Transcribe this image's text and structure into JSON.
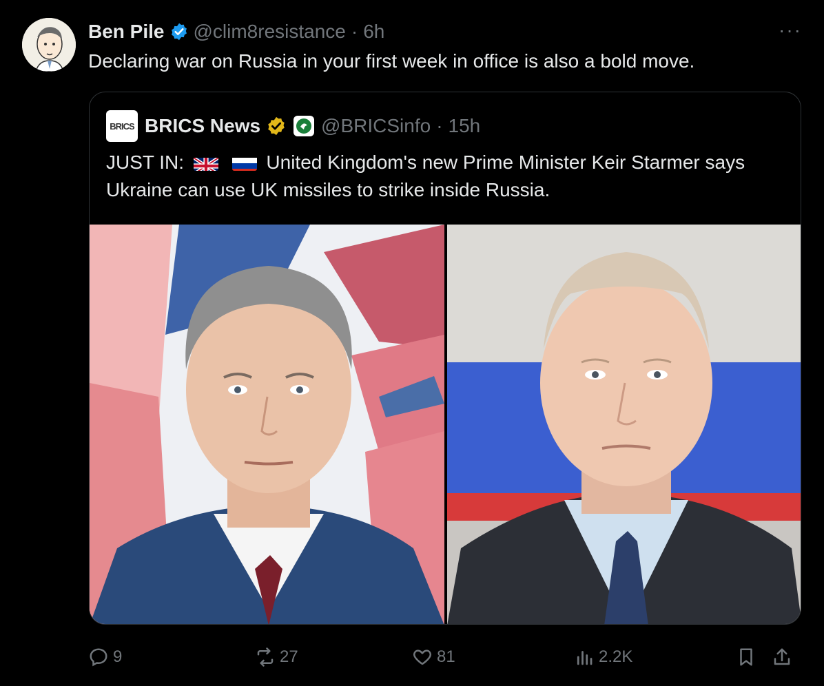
{
  "tweet": {
    "author_name": "Ben Pile",
    "handle": "@clim8resistance",
    "separator": "·",
    "time": "6h",
    "more_label": "···",
    "text": "Declaring war on Russia in your first week in office is also a bold move."
  },
  "quoted": {
    "logo_text": "BRICS",
    "author_name": "BRICS News",
    "handle": "@BRICSinfo",
    "separator": "·",
    "time": "15h",
    "text_prefix": "JUST IN:",
    "text_body": "United Kingdom's new Prime Minister Keir Starmer says Ukraine  can use UK missiles to strike inside Russia."
  },
  "actions": {
    "replies": "9",
    "reposts": "27",
    "likes": "81",
    "views": "2.2K"
  },
  "colors": {
    "background": "#000000",
    "text": "#e7e9ea",
    "muted": "#71767b",
    "verified_blue": "#1d9bf0",
    "verified_gold": "#e2b719",
    "border": "#2f3336"
  },
  "icons": [
    "verified-badge-icon",
    "more-icon",
    "gold-verified-badge-icon",
    "affiliate-badge-icon",
    "uk-flag-icon",
    "russia-flag-icon",
    "reply-icon",
    "repost-icon",
    "like-icon",
    "views-icon",
    "bookmark-icon",
    "share-icon"
  ]
}
